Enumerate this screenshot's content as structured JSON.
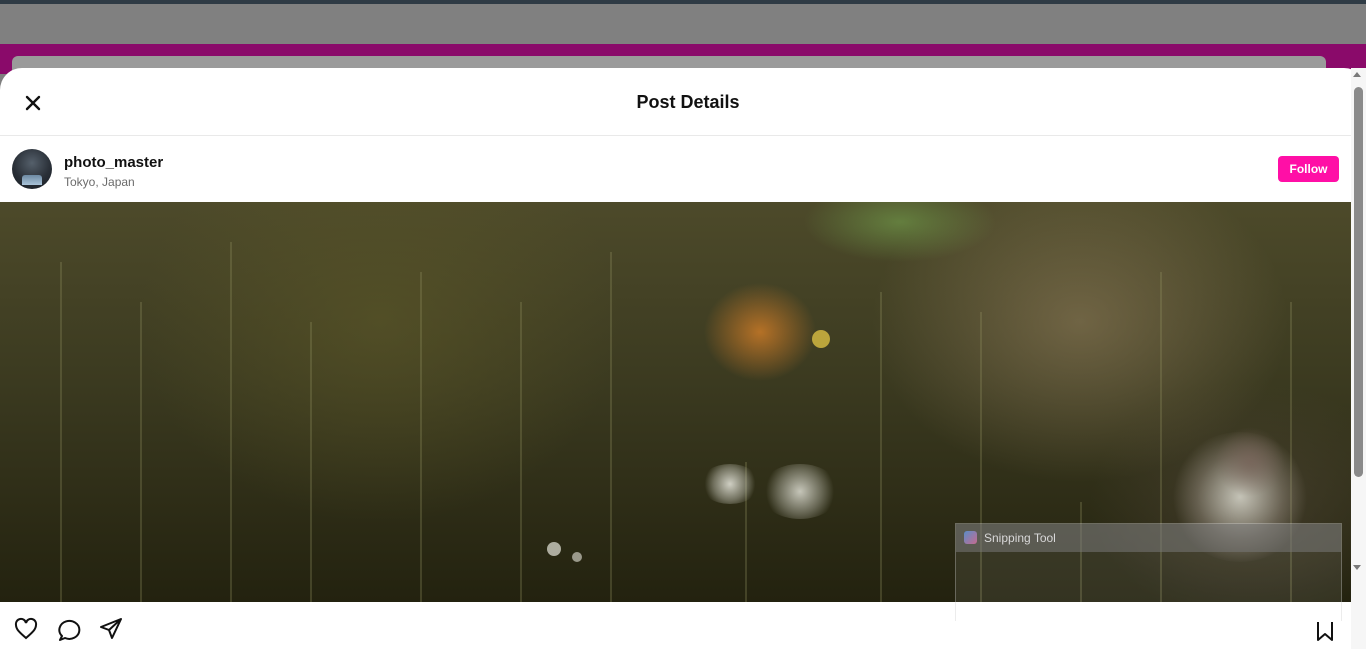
{
  "modal": {
    "title": "Post Details"
  },
  "post": {
    "username": "photo_master",
    "location": "Tokyo, Japan",
    "follow_label": "Follow"
  },
  "overlay": {
    "snipping_tool_title": "Snipping Tool"
  },
  "icons": {
    "close": "close-icon",
    "like": "heart-icon",
    "comment": "comment-icon",
    "share": "send-icon",
    "save": "bookmark-icon"
  },
  "colors": {
    "accent": "#ff0fa6",
    "backdrop_band": "#8a0a6a"
  }
}
